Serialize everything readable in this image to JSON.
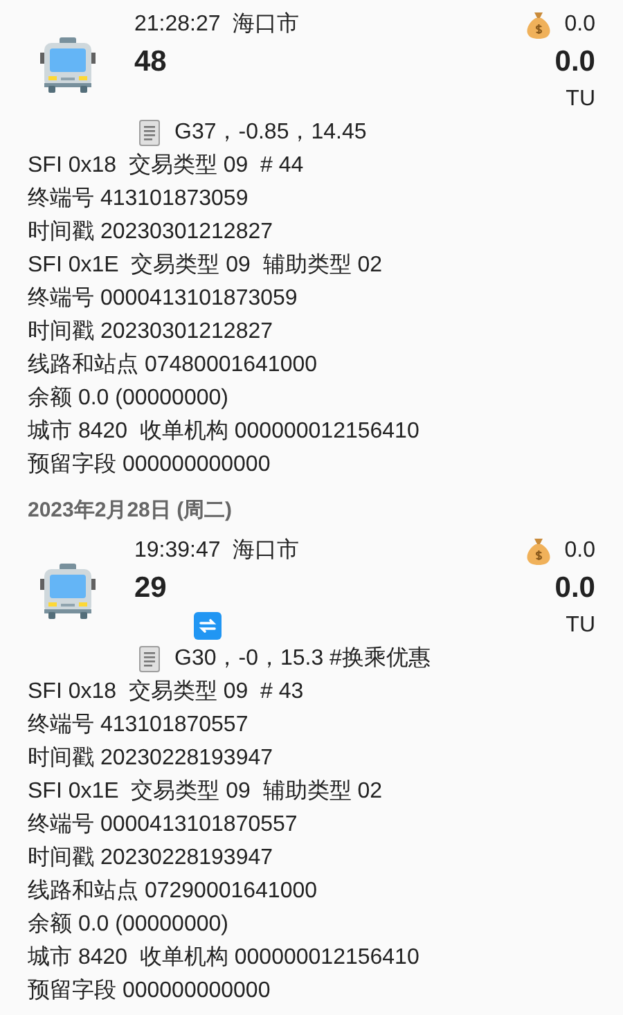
{
  "groups": [
    {
      "records": [
        {
          "time": "21:28:27",
          "city": "海口市",
          "route": "48",
          "balance_change": "0.0",
          "amount": "0.0",
          "unit": "TU",
          "transfer": false,
          "note": "G37，-0.85，14.45",
          "details": [
            "SFI 0x18  交易类型 09  # 44",
            "终端号 413101873059",
            "时间戳 20230301212827",
            "SFI 0x1E  交易类型 09  辅助类型 02",
            "终端号 0000413101873059",
            "时间戳 20230301212827",
            "线路和站点 07480001641000",
            "余额 0.0 (00000000)",
            "城市 8420  收单机构 000000012156410",
            "预留字段 000000000000"
          ]
        }
      ]
    },
    {
      "date": "2023年2月28日 (周二)",
      "records": [
        {
          "time": "19:39:47",
          "city": "海口市",
          "route": "29",
          "balance_change": "0.0",
          "amount": "0.0",
          "unit": "TU",
          "transfer": true,
          "note": "G30，-0，15.3 #换乘优惠",
          "details": [
            "SFI 0x18  交易类型 09  # 43",
            "终端号 413101870557",
            "时间戳 20230228193947",
            "SFI 0x1E  交易类型 09  辅助类型 02",
            "终端号 0000413101870557",
            "时间戳 20230228193947",
            "线路和站点 07290001641000",
            "余额 0.0 (00000000)",
            "城市 8420  收单机构 000000012156410",
            "预留字段 000000000000"
          ]
        }
      ]
    }
  ]
}
